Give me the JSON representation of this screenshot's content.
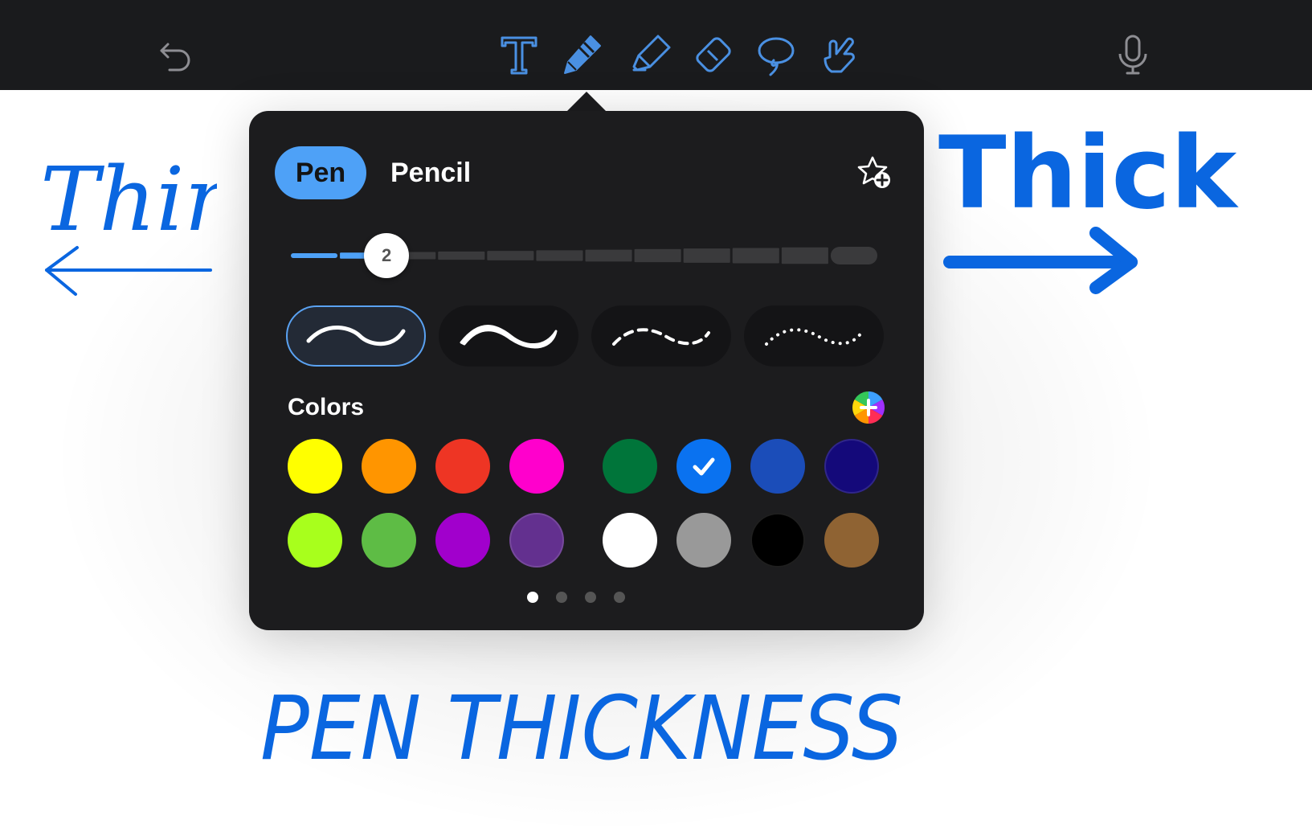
{
  "toolbar": {
    "buttons": [
      {
        "name": "undo-icon",
        "label": "Undo"
      },
      {
        "name": "text-tool-icon",
        "label": "Text"
      },
      {
        "name": "pen-tool-icon",
        "label": "Pen",
        "selected": true
      },
      {
        "name": "highlighter-tool-icon",
        "label": "Highlighter"
      },
      {
        "name": "eraser-tool-icon",
        "label": "Eraser"
      },
      {
        "name": "lasso-tool-icon",
        "label": "Lasso"
      },
      {
        "name": "hand-tool-icon",
        "label": "Touch"
      },
      {
        "name": "microphone-icon",
        "label": "Microphone"
      }
    ],
    "accent_color": "#4a90e2",
    "icon_color_inactive": "#8e8e93"
  },
  "popover": {
    "tabs": {
      "pen": "Pen",
      "pencil": "Pencil",
      "selected": "pen"
    },
    "favorite_icon": "star-plus-icon",
    "thickness": {
      "value": "2",
      "steps": 12,
      "level": 2
    },
    "stroke_styles": [
      "smooth",
      "variable",
      "dashed",
      "dotted"
    ],
    "selected_stroke": "smooth",
    "colors_label": "Colors",
    "add_color_icon": "color-wheel-plus-icon",
    "swatches": [
      "#ffff00",
      "#ff9500",
      "#ee3524",
      "#ff00cc",
      "#00753a",
      "#0a72f0",
      "#1b4db9",
      "#14097a",
      "#a8ff1c",
      "#5ebc45",
      "#a100cc",
      "#63308f",
      "#ffffff",
      "#999999",
      "#000000",
      "#8f6333"
    ],
    "selected_swatch": 5,
    "pages": 4,
    "current_page": 0
  },
  "annotations": {
    "thin": "Thin",
    "thick": "Thick",
    "title": "PEN THICKNESS",
    "ink_color": "#0a66e0"
  }
}
